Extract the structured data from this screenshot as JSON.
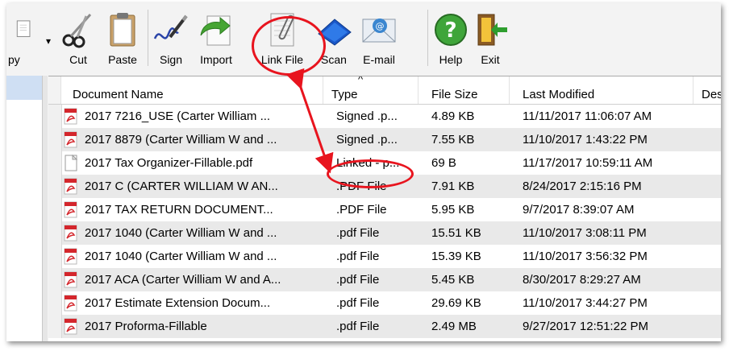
{
  "toolbar": {
    "partial_label": "py",
    "buttons": [
      {
        "label": "Cut",
        "icon": "scissors-icon"
      },
      {
        "label": "Paste",
        "icon": "clipboard-icon"
      },
      {
        "label": "Sign",
        "icon": "signature-pen-icon"
      },
      {
        "label": "Import",
        "icon": "import-arrow-icon"
      },
      {
        "label": "Link File",
        "icon": "link-file-icon"
      },
      {
        "label": "Scan",
        "icon": "scanner-icon"
      },
      {
        "label": "E-mail",
        "icon": "email-envelope-icon"
      },
      {
        "label": "Help",
        "icon": "help-question-icon"
      },
      {
        "label": "Exit",
        "icon": "exit-door-icon"
      }
    ]
  },
  "grid": {
    "columns": [
      "Document Name",
      "Type",
      "File Size",
      "Last Modified",
      "Des"
    ],
    "sort_indicator": "^",
    "rows": [
      {
        "name": "2017 7216_USE (Carter William ...",
        "type": "Signed .p...",
        "size": "4.89 KB",
        "modified": "11/11/2017 11:06:07 AM",
        "icon": "pdf-icon"
      },
      {
        "name": "2017 8879 (Carter William W and ...",
        "type": "Signed .p...",
        "size": "7.55 KB",
        "modified": "11/10/2017 1:43:22 PM",
        "icon": "pdf-icon"
      },
      {
        "name": "2017 Tax Organizer-Fillable.pdf",
        "type": "Linked - p...",
        "size": "69 B",
        "modified": "11/17/2017 10:59:11 AM",
        "icon": "blank-file-icon"
      },
      {
        "name": "2017 C (CARTER WILLIAM W AN...",
        "type": ".PDF File",
        "size": "7.91 KB",
        "modified": "8/24/2017 2:15:16 PM",
        "icon": "pdf-icon"
      },
      {
        "name": "2017 TAX RETURN DOCUMENT...",
        "type": ".PDF File",
        "size": "5.95 KB",
        "modified": "9/7/2017 8:39:07 AM",
        "icon": "pdf-icon"
      },
      {
        "name": "2017 1040 (Carter William W and ...",
        "type": ".pdf File",
        "size": "15.51 KB",
        "modified": "11/10/2017 3:08:11 PM",
        "icon": "pdf-icon"
      },
      {
        "name": "2017 1040 (Carter William W and ...",
        "type": ".pdf File",
        "size": "15.39 KB",
        "modified": "11/10/2017 3:56:32 PM",
        "icon": "pdf-icon"
      },
      {
        "name": "2017 ACA (Carter William W and A...",
        "type": ".pdf File",
        "size": "5.45 KB",
        "modified": "8/30/2017 8:29:27 AM",
        "icon": "pdf-icon"
      },
      {
        "name": "2017 Estimate Extension Docum...",
        "type": ".pdf File",
        "size": "29.69 KB",
        "modified": "11/10/2017 3:44:27 PM",
        "icon": "pdf-icon"
      },
      {
        "name": "2017 Proforma-Fillable",
        "type": ".pdf File",
        "size": "2.49 MB",
        "modified": "9/27/2017 12:51:22 PM",
        "icon": "pdf-icon"
      }
    ]
  },
  "colors": {
    "accent_red": "#e8141e",
    "row_alt": "#e9e9e9",
    "selection_blue": "#cfdff3",
    "pdf_red": "#d4262c"
  }
}
